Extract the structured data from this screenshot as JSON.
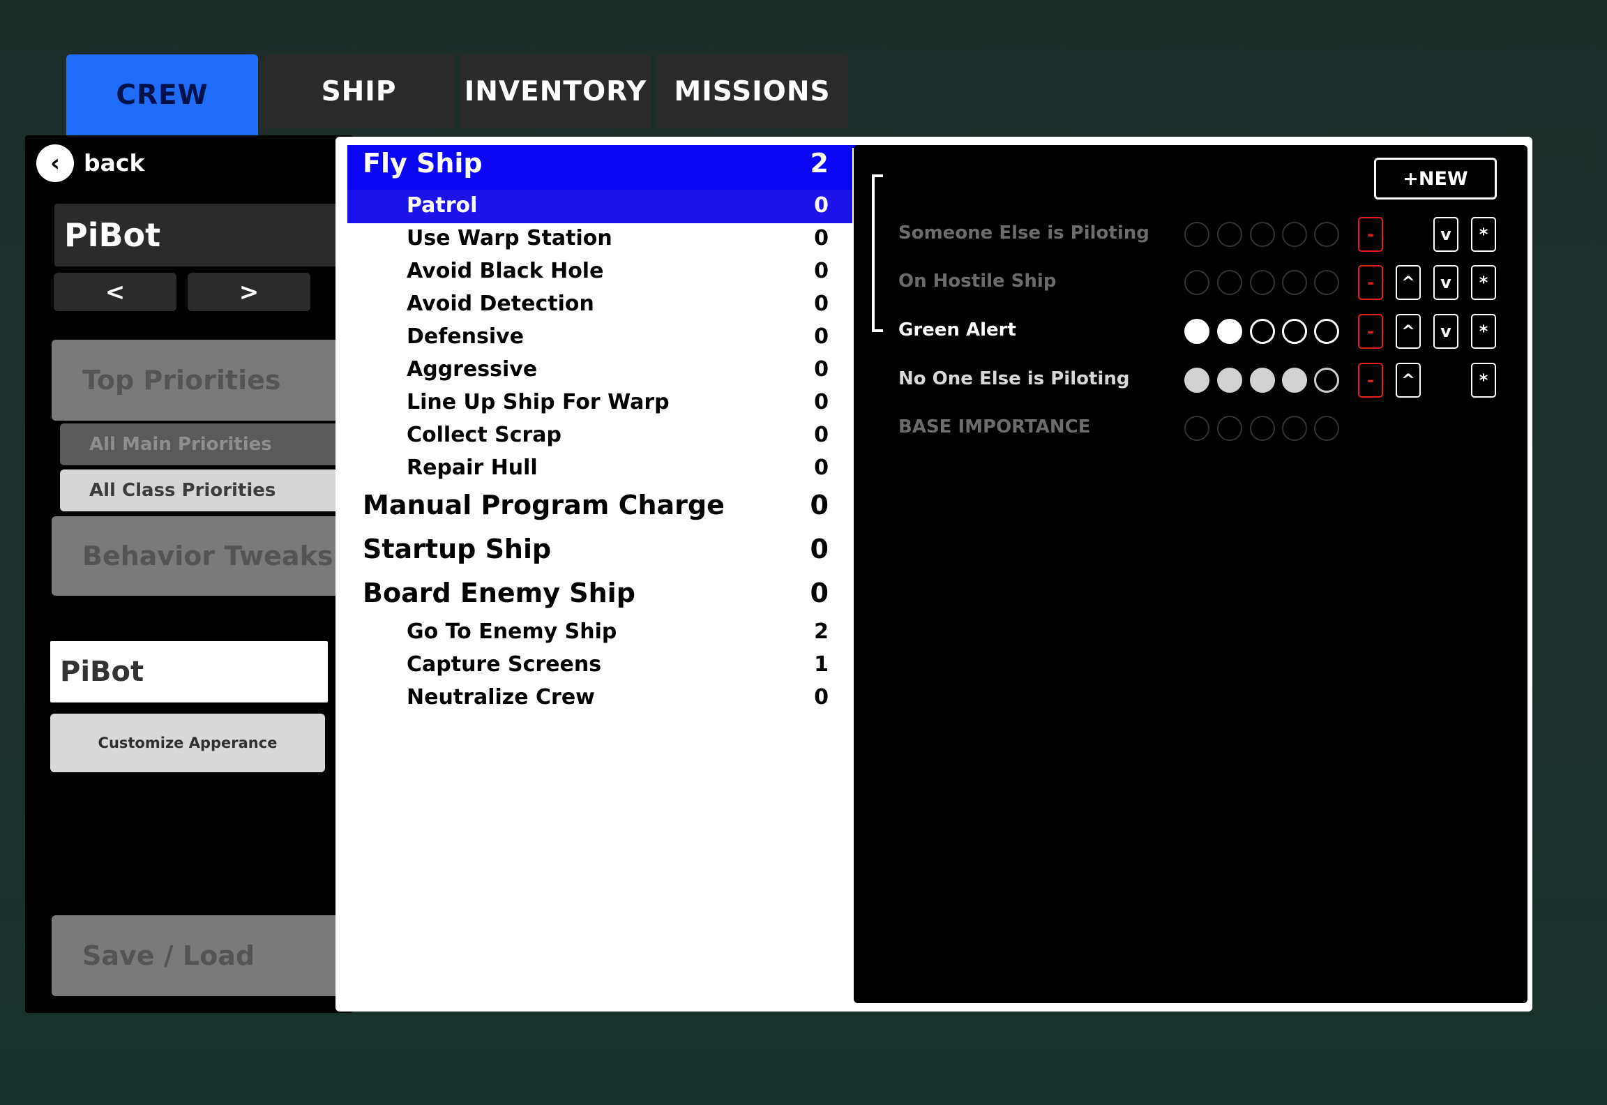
{
  "tabs": [
    {
      "label": "CREW",
      "active": true
    },
    {
      "label": "SHIP",
      "active": false
    },
    {
      "label": "INVENTORY",
      "active": false
    },
    {
      "label": "MISSIONS",
      "active": false
    }
  ],
  "left_panel": {
    "back_label": "back",
    "crew_name": "PiBot",
    "prev_label": "<",
    "next_label": ">",
    "top_priorities": "Top Priorities",
    "all_main_priorities": "All Main Priorities",
    "all_class_priorities": "All Class Priorities",
    "behavior_tweaks": "Behavior Tweaks",
    "name_input_value": "PiBot",
    "customize_label": "Customize Apperance",
    "save_load": "Save / Load"
  },
  "priority_list": [
    {
      "label": "Fly Ship",
      "value": "2",
      "level": "top",
      "selected": true
    },
    {
      "label": "Patrol",
      "value": "0",
      "level": "sub",
      "selected": true
    },
    {
      "label": "Use Warp Station",
      "value": "0",
      "level": "sub"
    },
    {
      "label": "Avoid Black Hole",
      "value": "0",
      "level": "sub"
    },
    {
      "label": "Avoid Detection",
      "value": "0",
      "level": "sub"
    },
    {
      "label": "Defensive",
      "value": "0",
      "level": "sub"
    },
    {
      "label": "Aggressive",
      "value": "0",
      "level": "sub"
    },
    {
      "label": "Line Up Ship For Warp",
      "value": "0",
      "level": "sub"
    },
    {
      "label": "Collect Scrap",
      "value": "0",
      "level": "sub"
    },
    {
      "label": "Repair Hull",
      "value": "0",
      "level": "sub"
    },
    {
      "label": "Manual Program Charge",
      "value": "0",
      "level": "top"
    },
    {
      "label": "Startup Ship",
      "value": "0",
      "level": "top"
    },
    {
      "label": "Board Enemy Ship",
      "value": "0",
      "level": "top"
    },
    {
      "label": "Go To Enemy Ship",
      "value": "2",
      "level": "sub"
    },
    {
      "label": "Capture Screens",
      "value": "1",
      "level": "sub"
    },
    {
      "label": "Neutralize Crew",
      "value": "0",
      "level": "sub"
    }
  ],
  "conditions_panel": {
    "new_button": "+NEW",
    "minus_glyph": "-",
    "up_glyph": "^",
    "down_glyph": "v",
    "star_glyph": "*",
    "rows": [
      {
        "label": "Someone Else is Piloting",
        "label_color": "#6c6c6c",
        "filled": 0,
        "dot_style": "dim",
        "buttons": [
          "minus",
          "down",
          "star"
        ]
      },
      {
        "label": "On Hostile Ship",
        "label_color": "#6c6c6c",
        "filled": 0,
        "dot_style": "dim",
        "buttons": [
          "minus",
          "up",
          "down",
          "star"
        ]
      },
      {
        "label": "Green Alert",
        "label_color": "#ffffff",
        "filled": 2,
        "dot_style": "white",
        "buttons": [
          "minus",
          "up",
          "down",
          "star"
        ]
      },
      {
        "label": "No One Else is Piloting",
        "label_color": "#d8d8d8",
        "filled": 4,
        "dot_style": "grey",
        "buttons": [
          "minus",
          "up",
          "star"
        ]
      },
      {
        "label": "BASE IMPORTANCE",
        "label_color": "#6c6c6c",
        "filled": 0,
        "dot_style": "dim",
        "buttons": []
      }
    ],
    "max_dots": 5
  },
  "colors": {
    "accent_blue": "#1f6cf8",
    "selection_blue": "#0a06f3",
    "minus_red": "#e0201f"
  }
}
